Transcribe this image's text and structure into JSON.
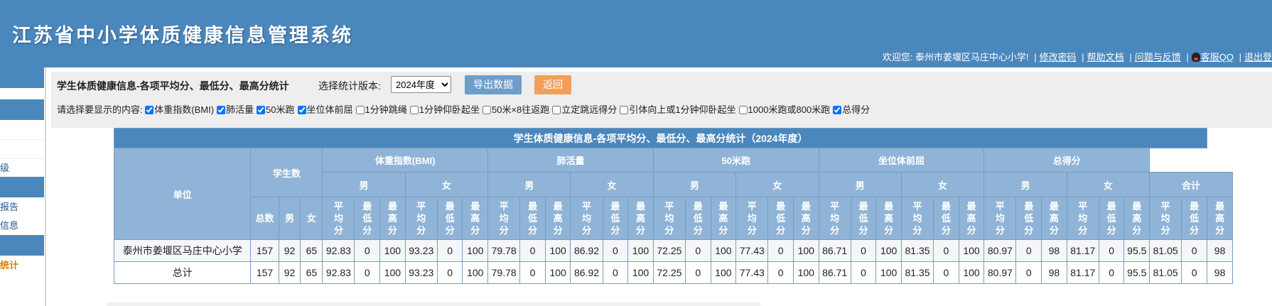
{
  "header": {
    "title": "江苏省中小学体质健康信息管理系统",
    "welcome": "欢迎您: 泰州市姜堰区马庄中心小学!",
    "links": [
      "修改密码",
      "帮助文档",
      "问题与反馈",
      "客服QQ",
      "退出登"
    ]
  },
  "sidebar": {
    "fragments": [
      "级",
      "报告",
      "信息",
      "统计"
    ]
  },
  "toolbar": {
    "title": "学生体质健康信息-各项平均分、最低分、最高分统计",
    "version_label": "选择统计版本:",
    "version_value": "2024年度",
    "export_label": "导出数据",
    "back_label": "返回",
    "content_label": "请选择要显示的内容:",
    "options": [
      {
        "label": "体重指数(BMI)",
        "checked": true
      },
      {
        "label": "肺活量",
        "checked": true
      },
      {
        "label": "50米跑",
        "checked": true
      },
      {
        "label": "坐位体前屈",
        "checked": true
      },
      {
        "label": "1分钟跳绳",
        "checked": false
      },
      {
        "label": "1分钟仰卧起坐",
        "checked": false
      },
      {
        "label": "50米×8往返跑",
        "checked": false
      },
      {
        "label": "立定跳远得分",
        "checked": false
      },
      {
        "label": "引体向上或1分钟仰卧起坐",
        "checked": false
      },
      {
        "label": "1000米跑或800米跑",
        "checked": false
      },
      {
        "label": "总得分",
        "checked": true
      }
    ]
  },
  "table": {
    "caption": "学生体质健康信息-各项平均分、最低分、最高分统计（2024年度）",
    "unit_header": "单位",
    "student_count_header": "学生数",
    "count_subheaders": [
      "总数",
      "男",
      "女"
    ],
    "groups": [
      "体重指数(BMI)",
      "肺活量",
      "50米跑",
      "坐位体前屈",
      "总得分"
    ],
    "gender_male": "男",
    "gender_female": "女",
    "gender_total": "合计",
    "stat_headers": [
      "平均分",
      "最低分",
      "最高分"
    ],
    "rows": [
      {
        "unit": "泰州市姜堰区马庄中心小学",
        "values": [
          "157",
          "92",
          "65",
          "92.83",
          "0",
          "100",
          "93.23",
          "0",
          "100",
          "79.78",
          "0",
          "100",
          "86.92",
          "0",
          "100",
          "72.25",
          "0",
          "100",
          "77.43",
          "0",
          "100",
          "86.71",
          "0",
          "100",
          "81.35",
          "0",
          "100",
          "80.97",
          "0",
          "98",
          "81.17",
          "0",
          "95.5",
          "81.05",
          "0",
          "98"
        ]
      },
      {
        "unit": "总计",
        "values": [
          "157",
          "92",
          "65",
          "92.83",
          "0",
          "100",
          "93.23",
          "0",
          "100",
          "79.78",
          "0",
          "100",
          "86.92",
          "0",
          "100",
          "72.25",
          "0",
          "100",
          "77.43",
          "0",
          "100",
          "86.71",
          "0",
          "100",
          "81.35",
          "0",
          "100",
          "80.97",
          "0",
          "98",
          "81.17",
          "0",
          "95.5",
          "81.05",
          "0",
          "98"
        ]
      }
    ]
  }
}
